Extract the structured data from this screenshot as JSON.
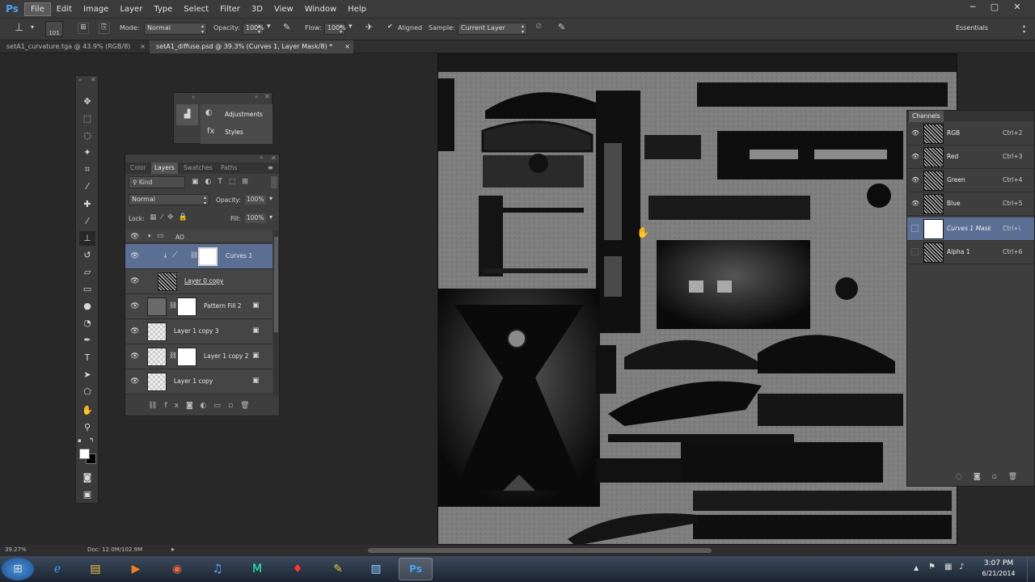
{
  "app": {
    "logo": "Ps"
  },
  "menu": [
    "File",
    "Edit",
    "Image",
    "Layer",
    "Type",
    "Select",
    "Filter",
    "3D",
    "View",
    "Window",
    "Help"
  ],
  "window_controls": [
    "─",
    "▢",
    "✕"
  ],
  "options": {
    "brush_size": "101",
    "mode_label": "Mode:",
    "mode_value": "Normal",
    "opacity_label": "Opacity:",
    "opacity_value": "100%",
    "flow_label": "Flow:",
    "flow_value": "100%",
    "aligned_label": "Aligned",
    "sample_label": "Sample:",
    "sample_value": "Current Layer",
    "workspace": "Essentials"
  },
  "tabs": [
    {
      "label": "setA1_curvature.tga @ 43.9% (RGB/8)",
      "close": "×"
    },
    {
      "label": "setA1_diffuse.psd @ 39.3% (Curves 1, Layer Mask/8) *",
      "close": "×"
    }
  ],
  "adjustments_panel": {
    "items": [
      "Adjustments",
      "Styles"
    ]
  },
  "layers_panel": {
    "tabs": [
      "Color",
      "Layers",
      "Swatches",
      "Paths"
    ],
    "filter_kind": "Kind",
    "blend_mode": "Normal",
    "opacity_label": "Opacity:",
    "opacity_value": "100%",
    "lock_label": "Lock:",
    "fill_label": "Fill:",
    "fill_value": "100%",
    "group_name": "AO",
    "layers": [
      {
        "name": "Curves 1",
        "selected": true
      },
      {
        "name": "Layer 0 copy",
        "selected": false
      },
      {
        "name": "Pattern Fill 2",
        "selected": false
      },
      {
        "name": "Layer 1 copy 3",
        "selected": false
      },
      {
        "name": "Layer 1 copy 2",
        "selected": false
      },
      {
        "name": "Layer 1 copy",
        "selected": false
      }
    ],
    "footer_fx": "fx"
  },
  "channels_panel": {
    "title": "Channels",
    "channels": [
      {
        "name": "RGB",
        "shortcut": "Ctrl+2",
        "selected": false
      },
      {
        "name": "Red",
        "shortcut": "Ctrl+3",
        "selected": false
      },
      {
        "name": "Green",
        "shortcut": "Ctrl+4",
        "selected": false
      },
      {
        "name": "Blue",
        "shortcut": "Ctrl+5",
        "selected": false
      },
      {
        "name": "Curves 1 Mask",
        "shortcut": "Ctrl+\\",
        "selected": true
      },
      {
        "name": "Alpha 1",
        "shortcut": "Ctrl+6",
        "selected": false
      }
    ]
  },
  "status": {
    "zoom": "39.27%",
    "doc": "Doc: 12.0M/102.9M"
  },
  "taskbar": {
    "time": "3:07 PM",
    "date": "6/21/2014"
  },
  "colors": {
    "accent": "#5b6f94",
    "logo": "#4aa3f0"
  }
}
